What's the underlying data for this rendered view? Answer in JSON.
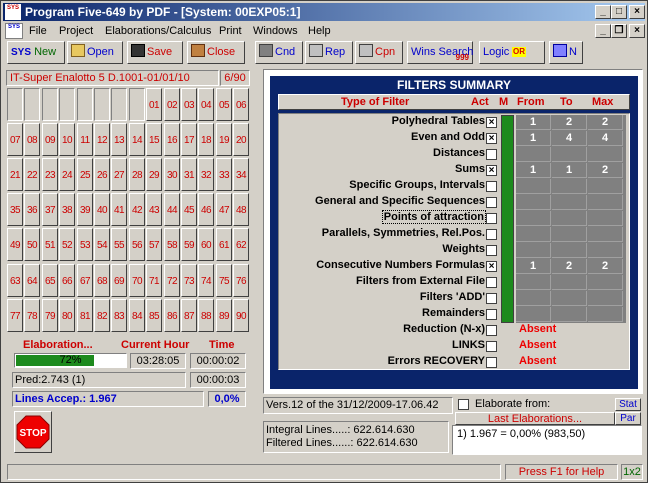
{
  "window": {
    "title": "Program Five-649 by PDF - [System: 00EXP05:1]",
    "title_icon": "SYS"
  },
  "title_buttons": {
    "minimize": "_",
    "maximize": "□",
    "close": "×"
  },
  "menu": [
    "File",
    "Project",
    "Elaborations/Calculus",
    "Print",
    "Windows",
    "Help"
  ],
  "mdi_buttons": {
    "minimize": "_",
    "restore": "❐",
    "close": "×"
  },
  "toolbar": [
    {
      "icon": "sys-new-icon",
      "label": "New",
      "prefix": "SYS"
    },
    {
      "icon": "open-folder-icon",
      "label": "Open"
    },
    {
      "icon": "save-disk-icon",
      "label": "Save"
    },
    {
      "icon": "close-door-icon",
      "label": "Close"
    },
    {
      "icon": "cnd-icon",
      "label": "Cnd"
    },
    {
      "icon": "printer-icon",
      "label": "Rep"
    },
    {
      "icon": "printer-icon",
      "label": "Cpn"
    },
    {
      "icon": "wins-search-icon",
      "label": "Wins Search",
      "sub": "999"
    },
    {
      "icon": "logic-icon",
      "label": "Logic",
      "extra": "OR AND NOT"
    },
    {
      "icon": "network-icon",
      "label": "N"
    }
  ],
  "left": {
    "header": "IT-Super Enalotto 5 D.1001-01/01/10",
    "count": "6/90",
    "numbers_row1": [
      "01",
      "02",
      "03",
      "04",
      "05",
      "06"
    ],
    "numbers": [
      [
        "07",
        "08",
        "09",
        "10",
        "11",
        "12",
        "13",
        "14",
        "15",
        "16",
        "17",
        "18",
        "19",
        "20"
      ],
      [
        "21",
        "22",
        "23",
        "24",
        "25",
        "26",
        "27",
        "28",
        "29",
        "30",
        "31",
        "32",
        "33",
        "34"
      ],
      [
        "35",
        "36",
        "37",
        "38",
        "39",
        "40",
        "41",
        "42",
        "43",
        "44",
        "45",
        "46",
        "47",
        "48"
      ],
      [
        "49",
        "50",
        "51",
        "52",
        "53",
        "54",
        "55",
        "56",
        "57",
        "58",
        "59",
        "60",
        "61",
        "62"
      ],
      [
        "63",
        "64",
        "65",
        "66",
        "67",
        "68",
        "69",
        "70",
        "71",
        "72",
        "73",
        "74",
        "75",
        "76"
      ],
      [
        "77",
        "78",
        "79",
        "80",
        "81",
        "82",
        "83",
        "84",
        "85",
        "86",
        "87",
        "88",
        "89",
        "90"
      ]
    ],
    "elaboration_label": "Elaboration...",
    "current_hour_label": "Current Hour",
    "time_label": "Time",
    "progress": 72,
    "progress_text": "72%",
    "current_hour": "03:28:05",
    "time": "00:00:02",
    "pred": "Pred:2.743 (1)",
    "pred_time": "00:00:03",
    "lines_accepted": "Lines Accep.: 1.967",
    "lines_pct": "0,0%",
    "stop_label": "STOP"
  },
  "filters": {
    "title": "FILTERS SUMMARY",
    "headers": {
      "type": "Type of Filter",
      "act": "Act",
      "m": "M",
      "from": "From",
      "to": "To",
      "max": "Max"
    },
    "rows": [
      {
        "name": "Polyhedral Tables",
        "checked": true,
        "from": "1",
        "to": "2",
        "max": "2"
      },
      {
        "name": "Even and Odd",
        "checked": true,
        "from": "1",
        "to": "4",
        "max": "4"
      },
      {
        "name": "Distances",
        "checked": false,
        "from": "",
        "to": "",
        "max": ""
      },
      {
        "name": "Sums",
        "checked": true,
        "from": "1",
        "to": "1",
        "max": "2"
      },
      {
        "name": "Specific Groups, Intervals",
        "checked": false,
        "from": "",
        "to": "",
        "max": ""
      },
      {
        "name": "General and Specific Sequences",
        "checked": false,
        "from": "",
        "to": "",
        "max": ""
      },
      {
        "name": "Points of attraction",
        "checked": false,
        "from": "",
        "to": "",
        "max": ""
      },
      {
        "name": "Parallels, Symmetries, Rel.Pos.",
        "checked": false,
        "from": "",
        "to": "",
        "max": ""
      },
      {
        "name": "Weights",
        "checked": false,
        "from": "",
        "to": "",
        "max": ""
      },
      {
        "name": "Consecutive Numbers Formulas",
        "checked": true,
        "from": "1",
        "to": "2",
        "max": "2"
      },
      {
        "name": "Filters from External File",
        "checked": false,
        "from": "",
        "to": "",
        "max": ""
      },
      {
        "name": "Filters 'ADD'",
        "checked": false,
        "from": "",
        "to": "",
        "max": ""
      },
      {
        "name": "Remainders",
        "checked": false,
        "from": "",
        "to": "",
        "max": ""
      }
    ],
    "extra_rows": [
      {
        "name": "Reduction (N-x)",
        "status": "Absent"
      },
      {
        "name": "LINKS",
        "status": "Absent"
      },
      {
        "name": "Errors RECOVERY",
        "status": "Absent"
      }
    ]
  },
  "bottom": {
    "version": "Vers.12 of the 31/12/2009-17.06.42",
    "integral_lines": "Integral Lines.....: 622.614.630",
    "filtered_lines": "Filtered Lines......: 622.614.630",
    "elaborate_from": "Elaborate from:",
    "last_elaborations": "Last Elaborations...",
    "stat": "Stat",
    "par": "Par",
    "result": "1) 1.967 = 0,00% (983,50)"
  },
  "status": {
    "help": "Press F1 for Help",
    "zoom": "1x2"
  }
}
